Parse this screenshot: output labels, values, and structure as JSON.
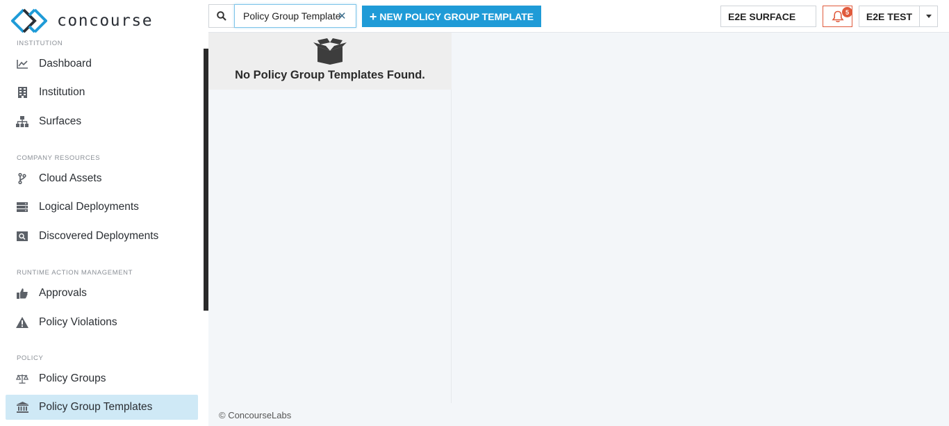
{
  "brand": {
    "name": "concourse"
  },
  "sidebar": {
    "sections": [
      {
        "label": "Institution",
        "items": [
          {
            "label": "Dashboard",
            "icon": "chart-line-icon"
          },
          {
            "label": "Institution",
            "icon": "building-icon"
          },
          {
            "label": "Surfaces",
            "icon": "sitemap-icon"
          }
        ]
      },
      {
        "label": "Company Resources",
        "items": [
          {
            "label": "Cloud Assets",
            "icon": "code-branch-icon"
          },
          {
            "label": "Logical Deployments",
            "icon": "server-icon"
          },
          {
            "label": "Discovered Deployments",
            "icon": "search-server-icon"
          }
        ]
      },
      {
        "label": "Runtime Action Management",
        "items": [
          {
            "label": "Approvals",
            "icon": "thumbs-up-icon"
          },
          {
            "label": "Policy Violations",
            "icon": "warning-icon"
          }
        ]
      },
      {
        "label": "Policy",
        "items": [
          {
            "label": "Policy Groups",
            "icon": "balance-scale-icon"
          },
          {
            "label": "Policy Group Templates",
            "icon": "institution-icon",
            "active": true
          }
        ]
      }
    ]
  },
  "topbar": {
    "search_value": "Policy Group Templates",
    "new_button_label": "NEW POLICY GROUP TEMPLATE",
    "surface_label": "E2E SURFACE",
    "notification_count": "5",
    "user_label": "E2E TEST"
  },
  "main": {
    "empty_message": "No Policy Group Templates Found."
  },
  "footer": {
    "text": "© ConcourseLabs"
  },
  "colors": {
    "accent": "#1f9bd7",
    "active_nav": "#cfe9f6",
    "alert": "#e05a3c"
  }
}
